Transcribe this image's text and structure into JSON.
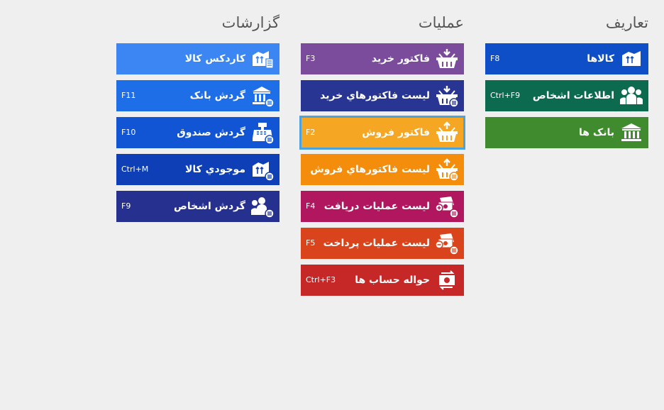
{
  "definitions": {
    "title": "تعاریف",
    "items": [
      {
        "label": "کالاها",
        "shortcut": "F8",
        "color": "#0e4fc7",
        "icon": "goods-icon"
      },
      {
        "label": "اطلاعات اشخاص",
        "shortcut": "Ctrl+F9",
        "color": "#0c6b4f",
        "icon": "people-icon"
      },
      {
        "label": "بانک ها",
        "shortcut": "",
        "color": "#3f8b2e",
        "icon": "bank-icon"
      }
    ]
  },
  "operations": {
    "title": "عملیات",
    "items": [
      {
        "label": "فاکتور خرید",
        "shortcut": "F3",
        "color": "#7b4b9c",
        "icon": "basket-in-icon"
      },
      {
        "label": "ليست فاکتورهاي خريد",
        "shortcut": "",
        "color": "#283593",
        "icon": "basket-list-icon"
      },
      {
        "label": "فاکتور فروش",
        "shortcut": "F2",
        "color": "#f5a623",
        "icon": "basket-out-icon"
      },
      {
        "label": "ليست فاکتورهاي فروش",
        "shortcut": "",
        "color": "#f48c0c",
        "icon": "basket-out-list-icon"
      },
      {
        "label": "ليست عمليات دريافت",
        "shortcut": "F4",
        "color": "#b0175f",
        "icon": "money-receive-icon"
      },
      {
        "label": "ليست عمليات پرداخت",
        "shortcut": "F5",
        "color": "#d9441c",
        "icon": "money-pay-icon"
      },
      {
        "label": "حواله حساب ها",
        "shortcut": "Ctrl+F3",
        "color": "#c62828",
        "icon": "transfer-icon"
      }
    ]
  },
  "reports": {
    "title": "گزارشات",
    "items": [
      {
        "label": "کاردکس کالا",
        "shortcut": "",
        "color": "#3b86f2",
        "icon": "goods-kardex-icon"
      },
      {
        "label": "گردش بانک",
        "shortcut": "F11",
        "color": "#1e6ee8",
        "icon": "bank-report-icon"
      },
      {
        "label": "گردش صندوق",
        "shortcut": "F10",
        "color": "#1255d4",
        "icon": "cash-register-icon"
      },
      {
        "label": "موجودي کالا",
        "shortcut": "Ctrl+M",
        "color": "#0e3fb6",
        "icon": "stock-icon"
      },
      {
        "label": "گردش اشخاص",
        "shortcut": "F9",
        "color": "#26318f",
        "icon": "people-report-icon"
      }
    ]
  }
}
